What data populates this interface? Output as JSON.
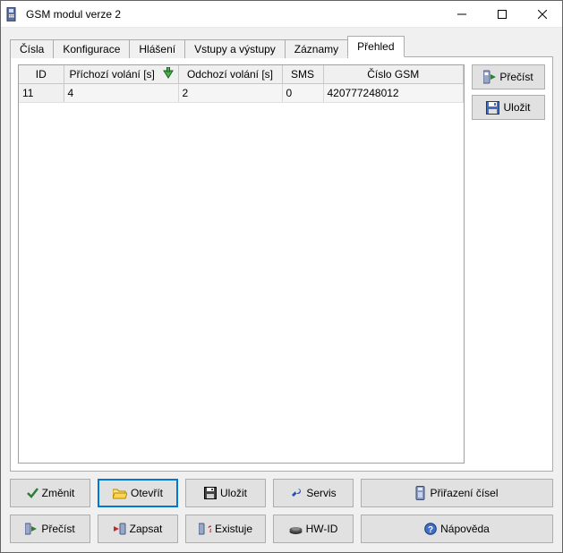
{
  "window": {
    "title": "GSM modul verze 2"
  },
  "tabs": [
    {
      "label": "Čísla"
    },
    {
      "label": "Konfigurace"
    },
    {
      "label": "Hlášení"
    },
    {
      "label": "Vstupy a výstupy"
    },
    {
      "label": "Záznamy"
    },
    {
      "label": "Přehled",
      "active": true
    }
  ],
  "table": {
    "columns": {
      "id": "ID",
      "incoming": "Příchozí volání [s]",
      "outgoing": "Odchozí volání [s]",
      "sms": "SMS",
      "gsm": "Číslo GSM"
    },
    "rows": [
      {
        "id": "11",
        "incoming": "4",
        "outgoing": "2",
        "sms": "0",
        "gsm": "420777248012"
      }
    ]
  },
  "side": {
    "read": "Přečíst",
    "save": "Uložit"
  },
  "bottom": {
    "zmenit": "Změnit",
    "otevrit": "Otevřít",
    "ulozit": "Uložit",
    "servis": "Servis",
    "prirazeni": "Přiřazení čísel",
    "precist": "Přečíst",
    "zapsat": "Zapsat",
    "existuje": "Existuje",
    "hwid": "HW-ID",
    "napoveda": "Nápověda"
  }
}
